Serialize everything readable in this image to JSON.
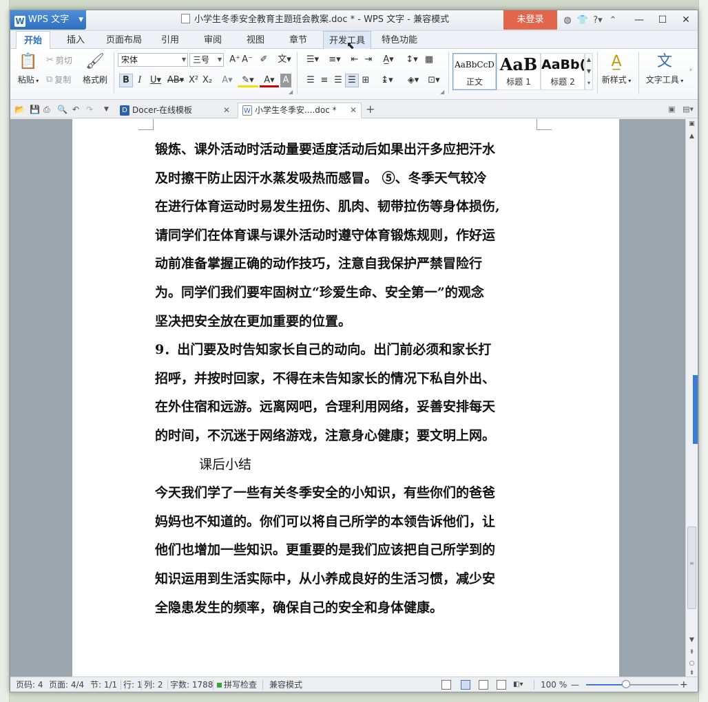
{
  "window": {
    "app_button": "WPS 文字",
    "title": "小学生冬季安全教育主题班会教案.doc * - WPS 文字 - 兼容模式",
    "login": "未登录",
    "title_icons": [
      "skin-icon",
      "shirt-icon",
      "?",
      "collapse-icon"
    ]
  },
  "ribbon_tabs": [
    "开始",
    "插入",
    "页面布局",
    "引用",
    "审阅",
    "视图",
    "章节",
    "开发工具",
    "特色功能"
  ],
  "ribbon": {
    "paste": "粘贴",
    "cut": "剪切",
    "copy": "复制",
    "format_painter": "格式刷",
    "font_name": "宋体",
    "font_size": "三号",
    "styles": [
      {
        "sample": "AaBbCcD",
        "name": "正文"
      },
      {
        "sample": "AaB",
        "name": "标题 1"
      },
      {
        "sample": "AaBb(",
        "name": "标题 2"
      }
    ],
    "new_style": "新样式",
    "text_tools": "文字工具"
  },
  "doc_tabs": [
    {
      "label": "Docer-在线模板",
      "active": false
    },
    {
      "label": "小学生冬季安....doc *",
      "active": true
    }
  ],
  "document": {
    "lines": [
      "锻炼、课外活动时活动量要适度活动后如果出汗多应把汗水",
      "及时擦干防止因汗水蒸发吸热而感冒。 ⑤、冬季天气较冷",
      "在进行体育运动时易发生扭伤、肌肉、韧带拉伤等身体损伤,",
      "请同学们在体育课与课外活动时遵守体育锻炼规则，作好运",
      "动前准备掌握正确的动作技巧，注意自我保护严禁冒险行",
      "为。同学们我们要牢固树立“珍爱生命、安全第一”的观念",
      "坚决把安全放在更加重要的位置。",
      "9．出门要及时告知家长自己的动向。出门前必须和家长打",
      "招呼，并按时回家，不得在未告知家长的情况下私自外出、",
      "在外住宿和远游。远离网吧，合理利用网络，妥善安排每天",
      "的时间，不沉迷于网络游戏，注意身心健康；要文明上网。",
      "课后小结",
      "今天我们学了一些有关冬季安全的小知识，有些你们的爸爸",
      "妈妈也不知道的。你们可以将自己所学的本领告诉他们，让",
      "他们也增加一些知识。更重要的是我们应该把自己所学到的",
      "知识运用到生活实际中，从小养成良好的生活习惯，减少安",
      "全隐患发生的频率，确保自己的安全和身体健康。"
    ]
  },
  "status": {
    "page_code": "页码: 4",
    "pages": "页面: 4/4",
    "section": "节: 1/1",
    "row": "行: 1",
    "col": "列: 2",
    "words": "字数: 1788",
    "spell": "拼写检查",
    "compat": "兼容模式",
    "zoom": "100 %",
    "zoom_value": 100
  },
  "colors": {
    "accent": "#2f6fc0",
    "login": "#e2664b",
    "spell_ok": "#3aa33a"
  }
}
